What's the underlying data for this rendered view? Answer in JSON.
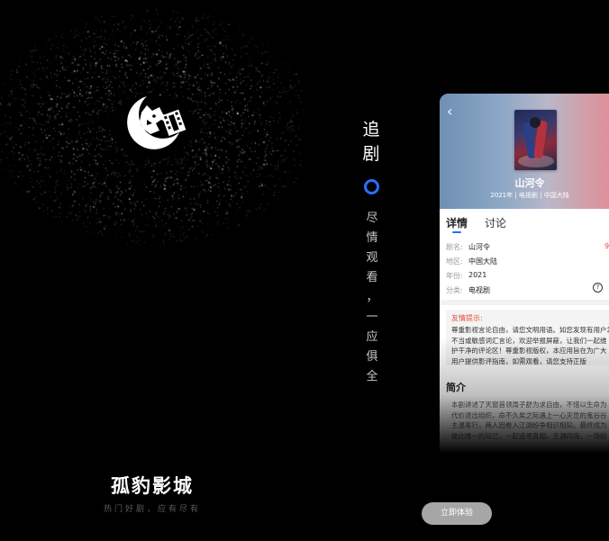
{
  "splash": {
    "title": "孤豹影城",
    "subtitle": "热门好剧，应有尽有",
    "logo_icon": "leopard-film-reel-logo"
  },
  "promo": {
    "headline_chars": [
      "追",
      "剧"
    ],
    "tagline_chars": [
      "尽",
      "情",
      "观",
      "看",
      "，",
      "一",
      "应",
      "俱",
      "全"
    ],
    "accent_color": "#2d6dff",
    "cta_label": "立即体验"
  },
  "detail": {
    "back_icon": "back-arrow-icon",
    "title": "山河令",
    "meta": "2021年 | 电视剧 | 中国大陆",
    "tabs": [
      {
        "label": "详情",
        "active": true
      },
      {
        "label": "讨论",
        "active": false
      }
    ],
    "info": [
      {
        "key": "剧名:",
        "value": "山河令"
      },
      {
        "key": "地区:",
        "value": "中国大陆"
      },
      {
        "key": "年份:",
        "value": "2021"
      },
      {
        "key": "分类:",
        "value": "电视剧"
      }
    ],
    "score_partial": "9",
    "help_icon": "question-icon",
    "notice_title": "友情提示:",
    "notice_lines": [
      "尊重影视言论自由，请您文明用语。如您发现有用户发",
      "不当或敏感词汇言论，欢迎举报屏蔽，让我们一起维",
      "护干净的评论区！尊重影视版权，本应用旨在为广大",
      "用户提供影评指南，如需观看，请您支持正版"
    ],
    "intro_title": "简介",
    "intro_lines": [
      "本剧讲述了天窗首领周子舒为求自由，不惜以生命为",
      "代价退出组织，命不久矣之际遇上一心灭世的鬼谷谷",
      "主温客行，两人因卷入江湖纷争相识相知，最终成为",
      "彼此唯一的知己，一起追寻真相，五湖四海，一场纷"
    ]
  }
}
